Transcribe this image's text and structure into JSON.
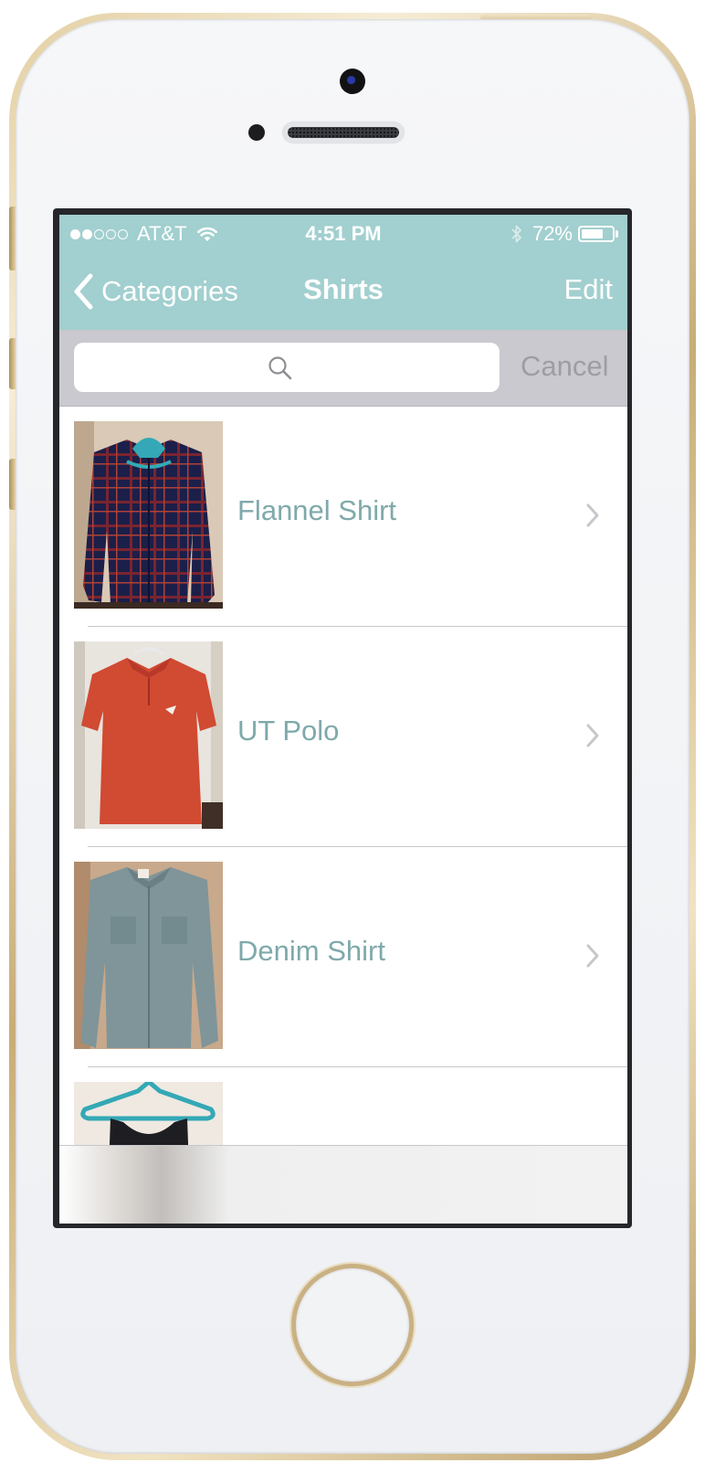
{
  "status_bar": {
    "carrier": "AT&T",
    "signal_bars_filled": 2,
    "signal_bars_total": 5,
    "time": "4:51 PM",
    "battery_percent_text": "72%",
    "battery_level": 0.72
  },
  "nav": {
    "back_label": "Categories",
    "title": "Shirts",
    "edit_label": "Edit"
  },
  "search": {
    "placeholder": "",
    "value": "",
    "cancel_label": "Cancel"
  },
  "items": [
    {
      "label": "Flannel Shirt",
      "image": "flannel-shirt-photo"
    },
    {
      "label": "UT Polo",
      "image": "orange-polo-photo"
    },
    {
      "label": "Denim Shirt",
      "image": "denim-shirt-photo"
    },
    {
      "label": "",
      "image": "black-top-photo"
    }
  ],
  "colors": {
    "accent": "#a2cfcf",
    "item_text": "#7fa9ab",
    "search_bar_bg": "#c9c9cf",
    "cancel_text": "#9d9da3"
  },
  "icons": [
    "back-chevron-icon",
    "search-icon",
    "disclosure-chevron-icon",
    "wifi-icon",
    "bluetooth-icon",
    "battery-icon"
  ]
}
